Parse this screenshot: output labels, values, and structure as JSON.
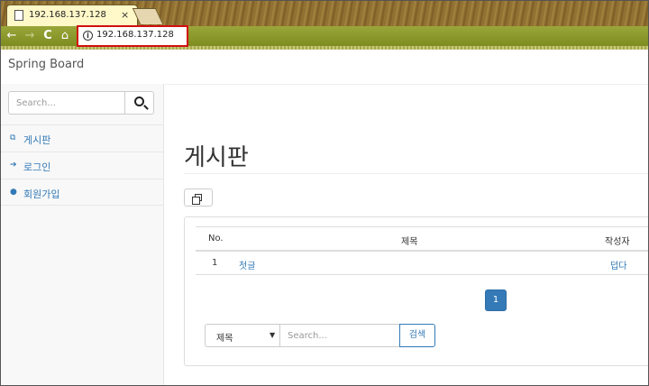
{
  "browser": {
    "tab_title": "192.168.137.128",
    "tab_close": "×",
    "url": "192.168.137.128",
    "nav": {
      "back": "←",
      "forward": "→",
      "reload": "C",
      "home": "⌂"
    }
  },
  "navbar": {
    "brand": "Spring Board"
  },
  "sidebar": {
    "search_placeholder": "Search...",
    "items": [
      {
        "label": "게시판",
        "icon": "copy-icon"
      },
      {
        "label": "로그인",
        "icon": "sign-in-icon"
      },
      {
        "label": "회원가입",
        "icon": "user-icon"
      }
    ]
  },
  "main": {
    "title": "게시판",
    "table": {
      "headers": {
        "no": "No.",
        "title": "제목",
        "writer": "작성자"
      },
      "rows": [
        {
          "no": "1",
          "title": "첫글",
          "writer": "덥다"
        }
      ]
    },
    "pagination": {
      "current": "1"
    },
    "search": {
      "select_value": "제목",
      "select_caret": "▼",
      "placeholder": "Search...",
      "button": "검색"
    }
  },
  "colors": {
    "link": "#337ab7",
    "url_highlight": "#d01010",
    "primary": "#337ab7"
  }
}
